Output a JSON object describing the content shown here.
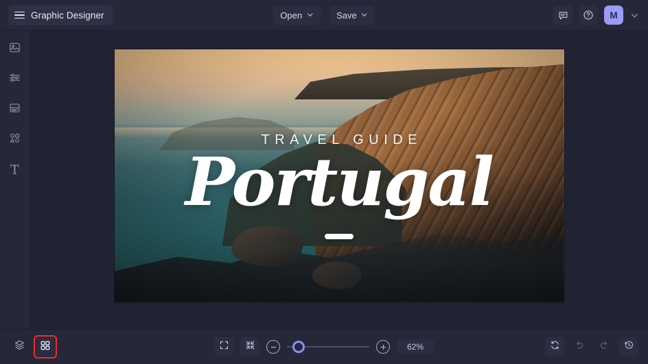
{
  "topbar": {
    "menu_icon": "hamburger-icon",
    "app_title": "Graphic Designer",
    "open_label": "Open",
    "save_label": "Save",
    "chevron_icon": "chevron-down-icon",
    "comment_icon": "comment-icon",
    "help_icon": "help-circle-icon",
    "avatar_initial": "M",
    "account_caret_icon": "chevron-down-icon"
  },
  "sidebar": {
    "items": [
      {
        "name": "image-tool",
        "icon": "image-icon"
      },
      {
        "name": "adjustments-tool",
        "icon": "sliders-icon"
      },
      {
        "name": "layout-tool",
        "icon": "layout-icon"
      },
      {
        "name": "shapes-tool",
        "icon": "shapes-icon"
      },
      {
        "name": "text-tool",
        "icon": "text-icon",
        "glyph": "T"
      }
    ]
  },
  "canvas": {
    "kicker": "TRAVEL GUIDE",
    "title": "Portugal",
    "divider": "white-dash-divider",
    "artwork": "coastal-cliffs-sunset-photo"
  },
  "bottombar": {
    "layers_icon": "layers-icon",
    "grid_icon": "grid-icon",
    "grid_selected": true,
    "selection_color": "#f32b2b",
    "fullscreen_icon": "expand-icon",
    "fit_icon": "collapse-icon",
    "zoom_out_label": "−",
    "zoom_in_label": "+",
    "zoom_value": "62%",
    "slider_percent": 8,
    "refresh_icon": "refresh-icon",
    "undo_icon": "undo-icon",
    "redo_icon": "redo-icon",
    "history_icon": "history-clock-icon"
  },
  "theme": {
    "bg": "#222433",
    "panel": "#262839",
    "accent": "#8c8ff5",
    "avatar_bg": "#9a9cf7"
  }
}
